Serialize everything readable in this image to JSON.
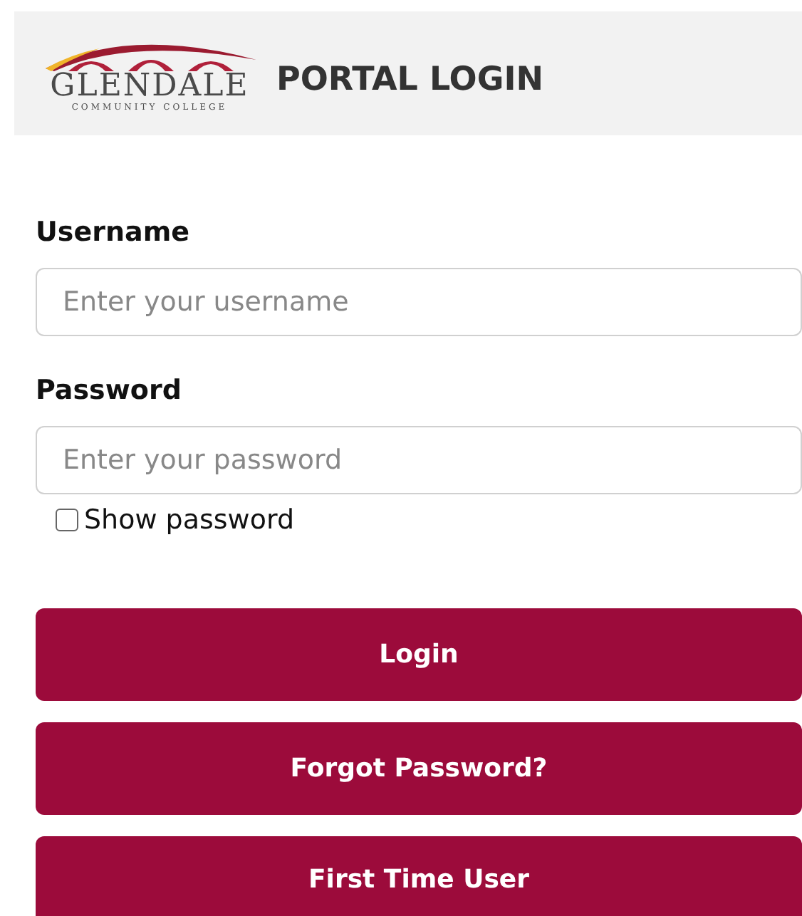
{
  "header": {
    "logo_name": "GLENDALE",
    "logo_subtitle": "COMMUNITY COLLEGE",
    "title": "PORTAL LOGIN"
  },
  "fields": [
    {
      "label": "Username",
      "placeholder": "Enter your username"
    },
    {
      "label": "Password",
      "placeholder": "Enter your password"
    }
  ],
  "show_password": {
    "label": "Show password",
    "checked": false
  },
  "buttons": [
    "Login",
    "Forgot Password?",
    "First Time User"
  ]
}
